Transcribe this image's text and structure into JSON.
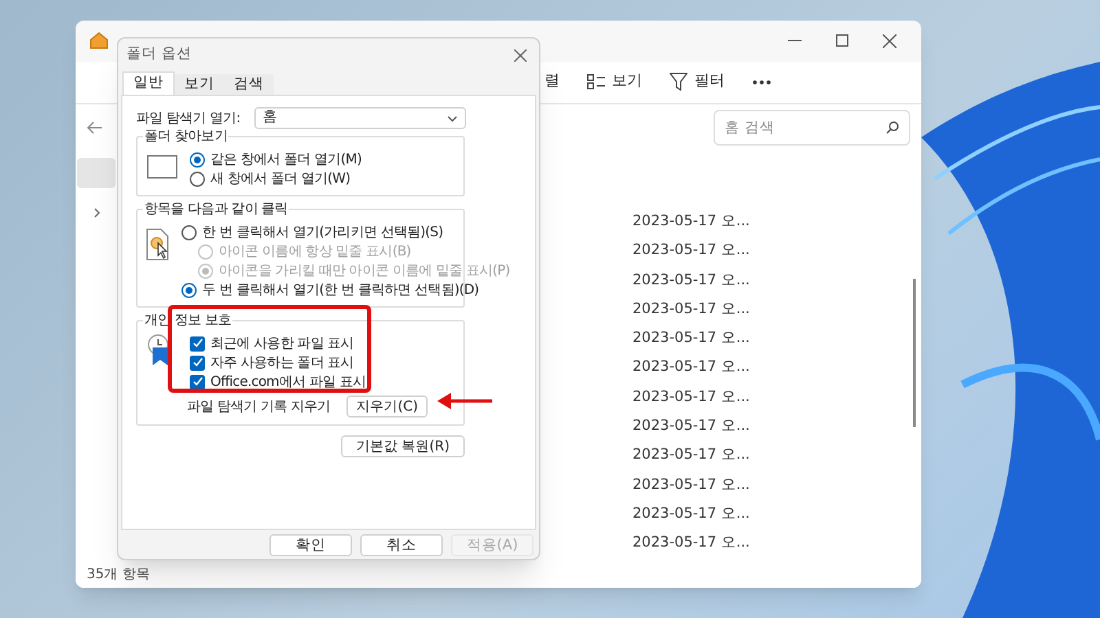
{
  "explorer": {
    "toolbar": [
      {
        "kind": "partial",
        "label": "렬"
      },
      {
        "kind": "view",
        "label": "보기"
      },
      {
        "kind": "filter",
        "label": "필터"
      },
      {
        "kind": "more"
      }
    ],
    "search": {
      "placeholder": "홈 검색"
    },
    "rows": [
      {
        "date": "2023-05-17 오..."
      },
      {
        "date": "2023-05-17 오..."
      },
      {
        "date": "2023-05-17 오..."
      },
      {
        "date": "2023-05-17 오..."
      },
      {
        "date": "2023-05-17 오..."
      },
      {
        "date": "2023-05-17 오..."
      },
      {
        "date": "2023-05-17 오..."
      },
      {
        "date": "2023-05-17 오..."
      },
      {
        "date": "2023-05-17 오..."
      },
      {
        "date": "2023-05-17 오..."
      },
      {
        "date": "2023-05-17 오..."
      },
      {
        "date": "2023-05-17 오..."
      }
    ],
    "status_bar": "35개 항목"
  },
  "dialog": {
    "title": "폴더 옵션",
    "tabs": [
      {
        "label": "일반",
        "selected": true
      },
      {
        "label": "보기",
        "selected": false
      },
      {
        "label": "검색",
        "selected": false
      }
    ],
    "open_in": {
      "label": "파일 탐색기 열기:",
      "value": "홈"
    },
    "groups": [
      {
        "title": "폴더 찾아보기",
        "kind": "window",
        "items": [
          {
            "kind": "radio",
            "label": "같은 창에서 폴더 열기(M)",
            "selected": true,
            "disabled": false
          },
          {
            "kind": "radio",
            "label": "새 창에서 폴더 열기(W)",
            "selected": false,
            "disabled": false
          }
        ]
      },
      {
        "title": "항목을 다음과 같이 클릭",
        "kind": "click",
        "items": [
          {
            "kind": "radio",
            "label": "한 번 클릭해서 열기(가리키면 선택됨)(S)",
            "selected": false,
            "disabled": false,
            "children": [
              {
                "kind": "radio",
                "label": "아이콘 이름에 항상 밑줄 표시(B)",
                "selected": false,
                "disabled": true
              },
              {
                "kind": "radio",
                "label": "아이콘을 가리킬 때만 아이콘 이름에 밑줄 표시(P)",
                "selected": true,
                "disabled": true
              }
            ]
          },
          {
            "kind": "radio",
            "label": "두 번 클릭해서 열기(한 번 클릭하면 선택됨)(D)",
            "selected": true,
            "disabled": false
          }
        ]
      },
      {
        "title": "개인 정보 보호",
        "kind": "privacy",
        "items": [
          {
            "kind": "checkbox",
            "label": "최근에 사용한 파일 표시",
            "checked": true
          },
          {
            "kind": "checkbox",
            "label": "자주 사용하는 폴더 표시",
            "checked": true
          },
          {
            "kind": "checkbox",
            "label": "Office.com에서 파일 표시",
            "checked": true
          }
        ],
        "clear": {
          "label": "파일 탐색기 기록 지우기",
          "button": "지우기(C)"
        }
      }
    ],
    "restore_button": "기본값 복원(R)",
    "buttons": [
      {
        "label": "확인",
        "disabled": false
      },
      {
        "label": "취소",
        "disabled": false
      },
      {
        "label": "적용(A)",
        "disabled": true
      }
    ]
  }
}
